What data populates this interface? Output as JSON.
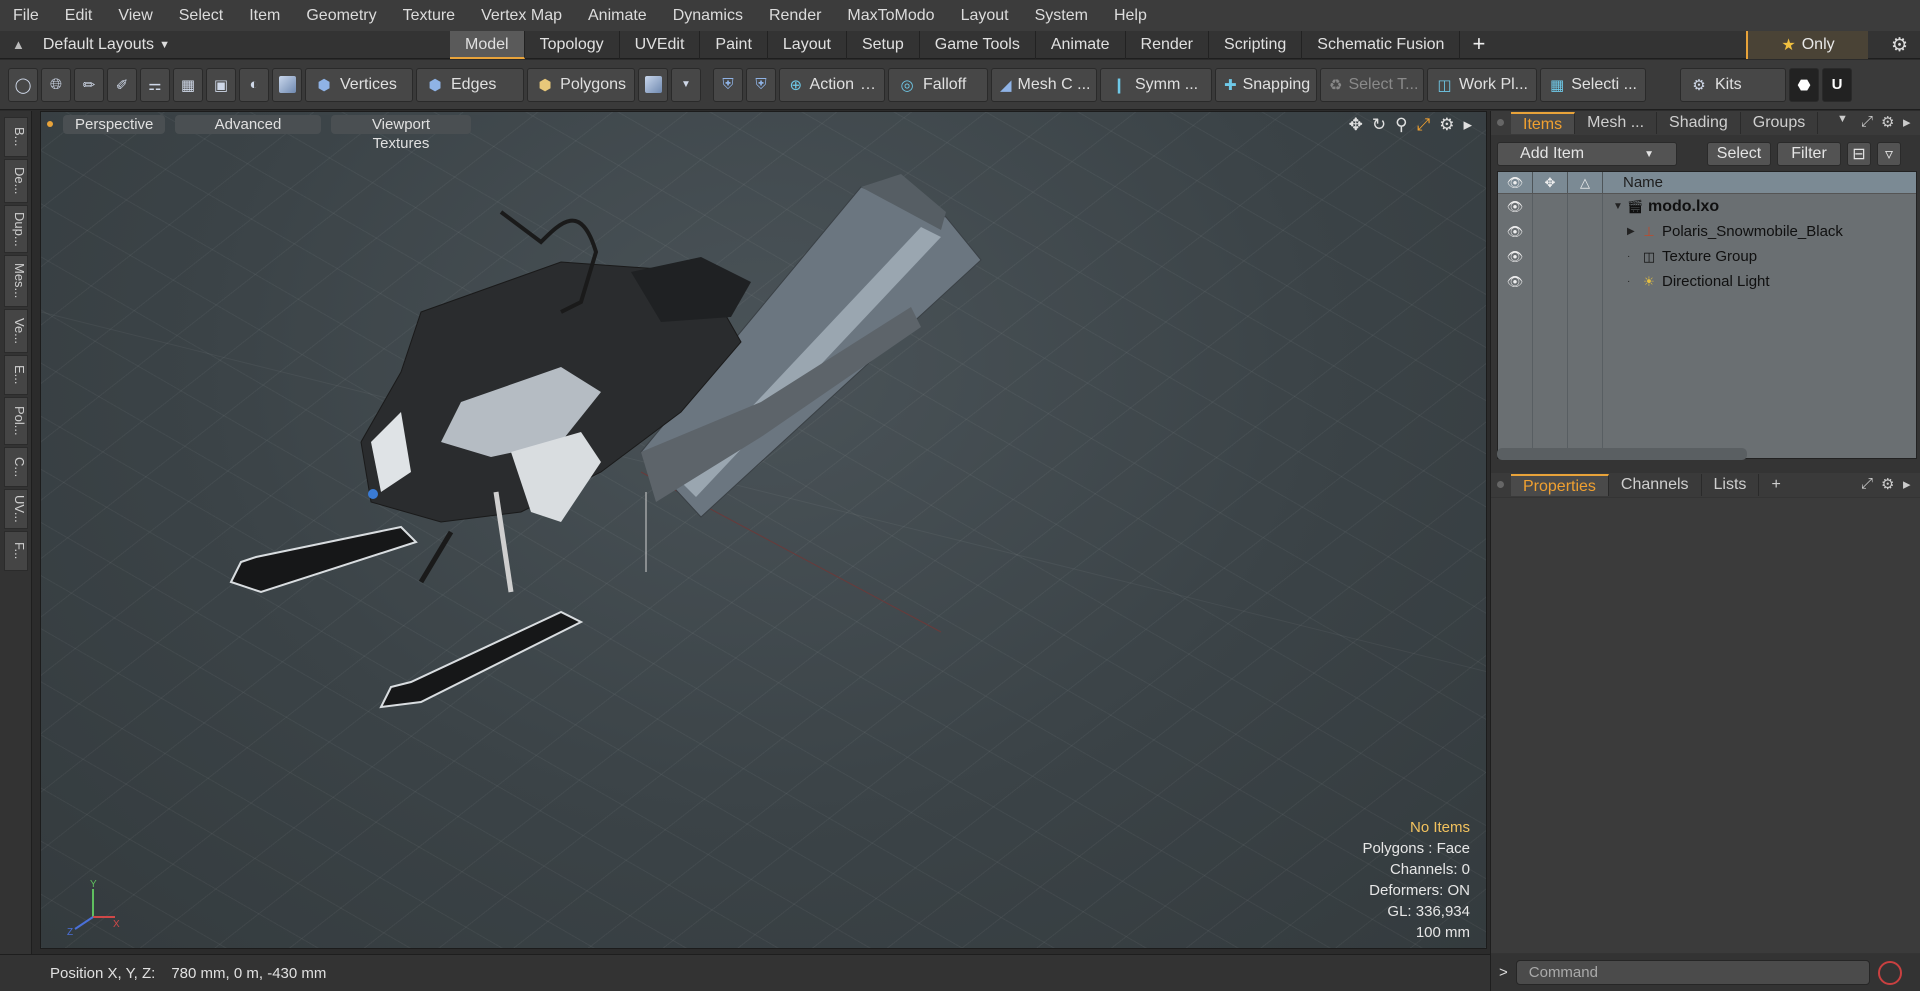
{
  "menu": [
    "File",
    "Edit",
    "View",
    "Select",
    "Item",
    "Geometry",
    "Texture",
    "Vertex Map",
    "Animate",
    "Dynamics",
    "Render",
    "MaxToModo",
    "Layout",
    "System",
    "Help"
  ],
  "layout": {
    "selector": "Default Layouts",
    "tabs": [
      "Model",
      "Topology",
      "UVEdit",
      "Paint",
      "Layout",
      "Setup",
      "Game Tools",
      "Animate",
      "Render",
      "Scripting",
      "Schematic Fusion"
    ],
    "active_tab": "Model",
    "plus": "+",
    "only_label": "Only"
  },
  "toolbar": {
    "vertices": "Vertices",
    "edges": "Edges",
    "polygons": "Polygons",
    "action": "Action",
    "falloff": "Falloff",
    "mesh_c": "Mesh C ...",
    "symm": "Symm ...",
    "snapping": "Snapping",
    "select_t": "Select T...",
    "work_pl": "Work Pl...",
    "selecti": "Selecti ...",
    "kits": "Kits"
  },
  "left_strip": [
    "B...",
    "De...",
    "Dup...",
    "Mes...",
    "Ve...",
    "E...",
    "Pol...",
    "C...",
    "UV...",
    "F..."
  ],
  "viewport": {
    "buttons": [
      "Perspective",
      "Advanced",
      "Viewport Textures"
    ],
    "info": {
      "selection": "No Items",
      "polygons": "Polygons : Face",
      "channels": "Channels: 0",
      "deformers": "Deformers: ON",
      "gl": "GL: 336,934",
      "unit": "100 mm"
    },
    "axis": {
      "x": "X",
      "y": "Y",
      "z": "Z"
    }
  },
  "status": {
    "label": "Position X, Y, Z:",
    "value": "780 mm, 0 m, -430 mm"
  },
  "items_panel": {
    "tabs": [
      "Items",
      "Mesh ...",
      "Shading",
      "Groups"
    ],
    "active_tab": "Items",
    "add_item": "Add Item",
    "select": "Select",
    "filter": "Filter",
    "column_name": "Name",
    "rows": [
      {
        "name": "modo.lxo",
        "icon": "scene-icon"
      },
      {
        "name": "Polaris_Snowmobile_Black",
        "icon": "mesh-group-icon"
      },
      {
        "name": "Texture Group",
        "icon": "texture-group-icon"
      },
      {
        "name": "Directional Light",
        "icon": "light-icon"
      }
    ]
  },
  "props_panel": {
    "tabs": [
      "Properties",
      "Channels",
      "Lists"
    ],
    "active_tab": "Properties",
    "plus": "+"
  },
  "command": {
    "placeholder": "Command"
  },
  "colors": {
    "accent": "#e8a33a",
    "info_highlight": "#f2c25e",
    "items_bg": "#6a6f72"
  }
}
